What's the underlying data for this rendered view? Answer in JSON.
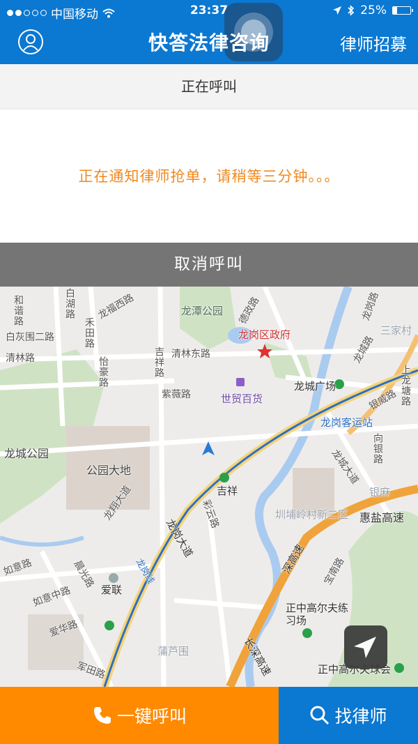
{
  "status_bar": {
    "carrier": "中国移动",
    "time": "23:37",
    "battery": "25%",
    "battery_level": 0.25,
    "signal_bars_filled": 2,
    "signal_bars_total": 5
  },
  "nav": {
    "title": "快答法律咨询",
    "right_label": "律师招募",
    "avatar_icon": "user-avatar-icon"
  },
  "calling": {
    "header": "正在呼叫",
    "message": "正在通知律师抢单，请稍等三分钟。。。",
    "cancel_label": "取消呼叫"
  },
  "map": {
    "labels": [
      "龙城公园",
      "公园大地",
      "龙潭公园",
      "龙岗区政府",
      "世贸百货",
      "龙城广场",
      "龙岗客运站",
      "吉祥",
      "爱联",
      "圳埔岭村新二区",
      "惠盐高速",
      "正中高尔夫练习场",
      "正中高尔夫球会",
      "清林东路",
      "紫薇路",
      "白灰围二路",
      "清林路",
      "和谐路",
      "白湖路",
      "禾田路",
      "怡豪路",
      "吉祥路",
      "龙福西路",
      "德政路",
      "龙岗路",
      "三家村",
      "龙城路",
      "上龙塘路",
      "银威路",
      "向银路",
      "银麻",
      "龙翔大道",
      "龙岗大道",
      "龙岗线",
      "如意路",
      "如意中路",
      "晨光路",
      "爱华路",
      "蒲芦围",
      "军田路",
      "长深高速",
      "深高速",
      "龙城大道",
      "宝南路",
      "彩云路"
    ],
    "locate_icon": "navigate-arrow-icon"
  },
  "bottom": {
    "call_label": "一键呼叫",
    "find_label": "找律师",
    "call_color": "#ff8a00",
    "find_color": "#0b78d1"
  },
  "colors": {
    "brand_blue": "#0b78d1",
    "accent_orange": "#ff8a00",
    "message_orange": "#f0891e",
    "cancel_gray": "#757575"
  }
}
